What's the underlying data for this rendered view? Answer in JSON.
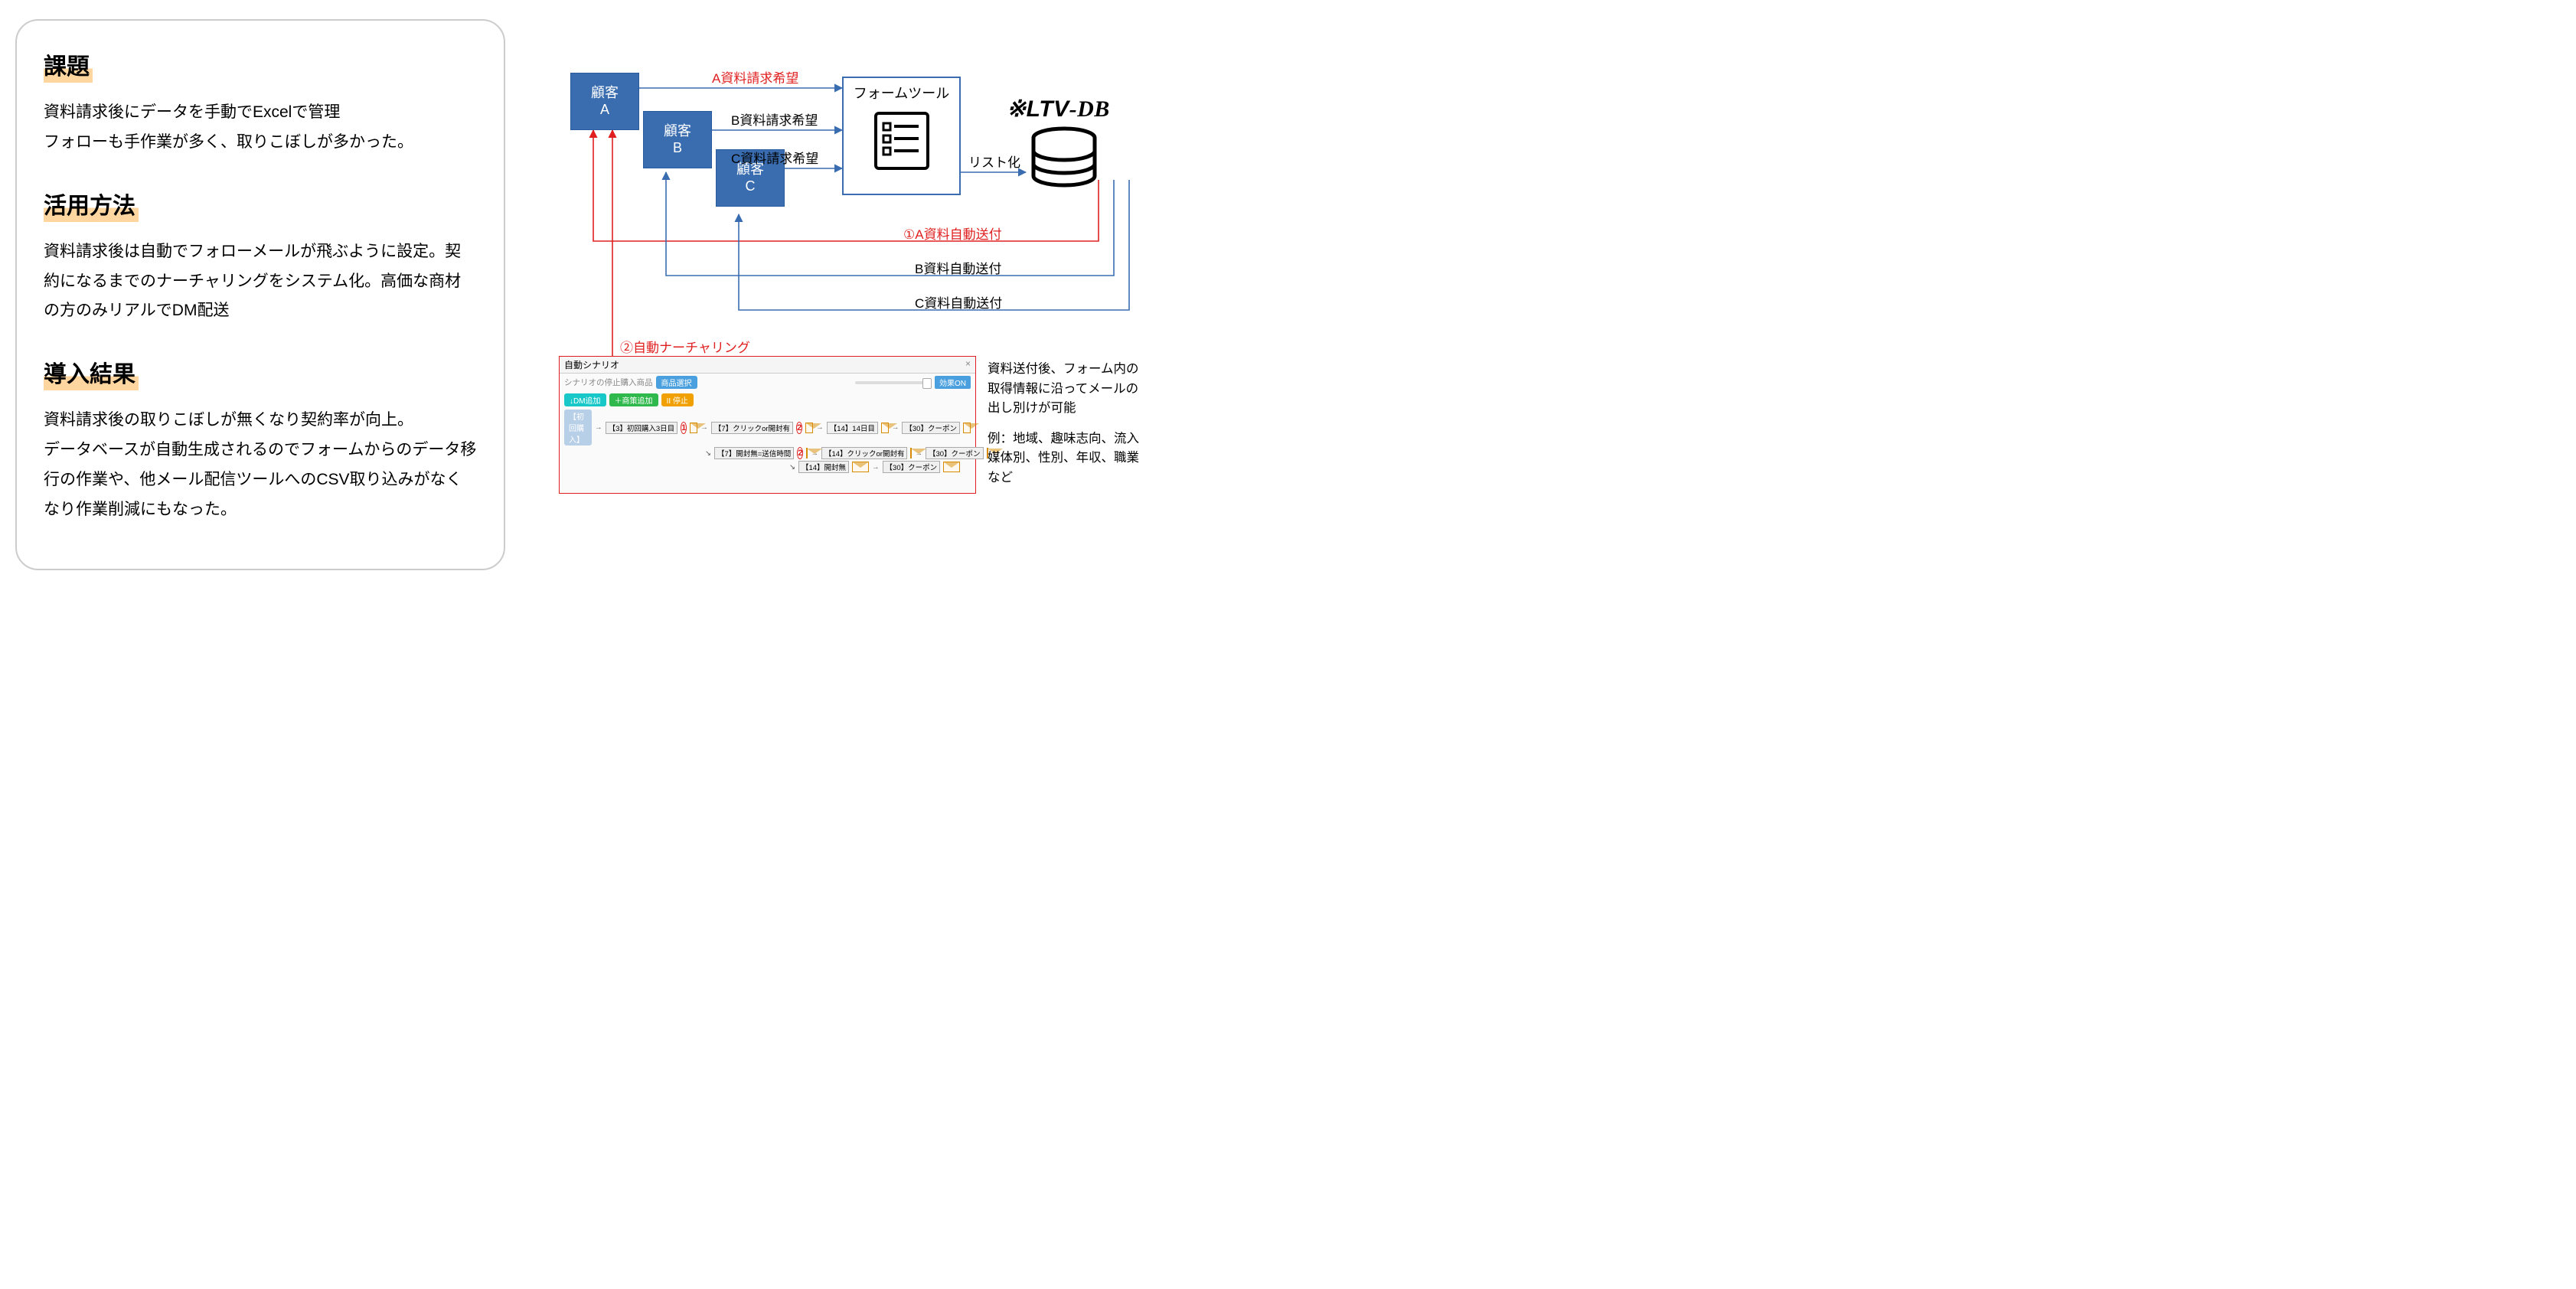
{
  "left": {
    "s1_title": "課題",
    "s1_body": "資料請求後にデータを手動でExcelで管理\nフォローも手作業が多く、取りこぼしが多かった。",
    "s2_title": "活用方法",
    "s2_body": "資料請求後は自動でフォローメールが飛ぶように設定。契約になるまでのナーチャリングをシステム化。高価な商材の方のみリアルでDM配送",
    "s3_title": "導入結果",
    "s3_body": "資料請求後の取りこぼしが無くなり契約率が向上。\nデータベースが自動生成されるのでフォームからのデータ移行の作業や、他メール配信ツールへのCSV取り込みがなくなり作業削減にもなった。"
  },
  "diagram": {
    "customers": {
      "a": "顧客\nA",
      "b": "顧客\nB",
      "c": "顧客\nC"
    },
    "req_labels": {
      "a": "A資料請求希望",
      "b": "B資料請求希望",
      "c": "C資料請求希望"
    },
    "form_tool": "フォームツール",
    "listify": "リスト化",
    "ltv_logo": "LTV-DB",
    "auto_send": {
      "a": "①A資料自動送付",
      "b": "B資料自動送付",
      "c": "C資料自動送付"
    },
    "auto_nurturing": "②自動ナーチャリング",
    "scenario": {
      "window_title": "自動シナリオ",
      "subtitle": "シナリオの停止購入商品",
      "select_btn": "商品選択",
      "effect_on": "効果ON",
      "pills": {
        "dm": "↓DM追加",
        "add": "＋商策追加",
        "pause": "II 停止"
      },
      "start": "【初回購入】",
      "nodes": {
        "n3": "【3】初回購入3日目",
        "n7a": "【7】クリックor開封有",
        "n7b": "【7】開封無=送信時間",
        "n14": "【14】14日目",
        "n14b": "【14】クリックor開封有",
        "n14c": "【14】開封無",
        "n30": "【30】クーポン"
      },
      "circ1": "1",
      "circ2": "2"
    },
    "notes": {
      "p1": "資料送付後、フォーム内の取得情報に沿ってメールの出し別けが可能",
      "p2": "例：地域、趣味志向、流入媒体別、性別、年収、職業など"
    }
  }
}
